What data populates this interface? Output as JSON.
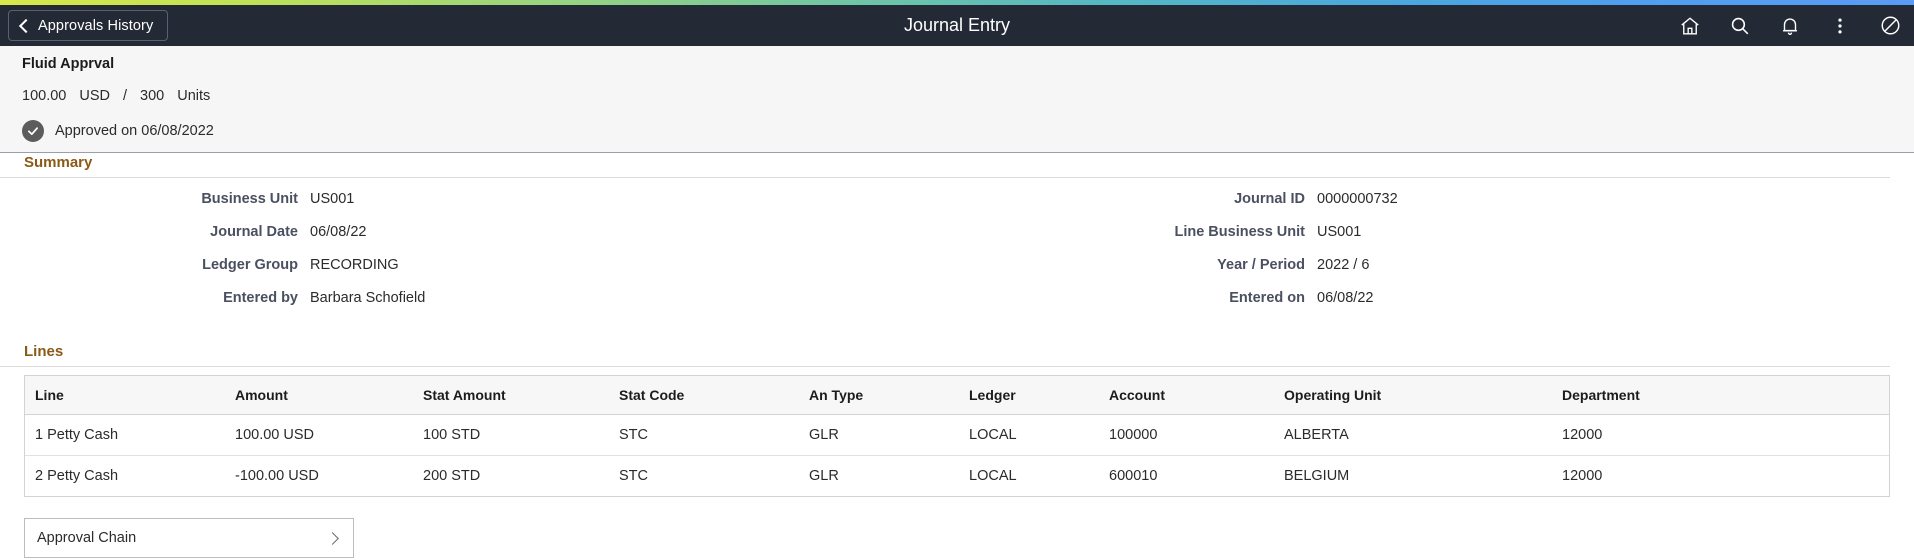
{
  "header": {
    "back_label": "Approvals History",
    "title": "Journal Entry",
    "icons": [
      {
        "name": "home-icon",
        "label": "Home"
      },
      {
        "name": "search-icon",
        "label": "Search"
      },
      {
        "name": "notifications-bell-icon",
        "label": "Notifications"
      },
      {
        "name": "actions-menu-icon",
        "label": "Actions"
      },
      {
        "name": "navbar-icon",
        "label": "NavBar"
      }
    ]
  },
  "info_band": {
    "fluid_title": "Fluid Apprval",
    "amount": "100.00",
    "currency": "USD",
    "separator": "/",
    "quantity": "300",
    "uom": "Units",
    "approval_status": "Approved on 06/08/2022"
  },
  "summary": {
    "heading": "Summary",
    "left_fields": [
      {
        "label": "Business Unit",
        "value": "US001"
      },
      {
        "label": "Journal Date",
        "value": "06/08/22"
      },
      {
        "label": "Ledger Group",
        "value": "RECORDING"
      },
      {
        "label": "Entered by",
        "value": "Barbara Schofield"
      }
    ],
    "right_fields": [
      {
        "label": "Journal ID",
        "value": "0000000732"
      },
      {
        "label": "Line Business Unit",
        "value": "US001"
      },
      {
        "label": "Year / Period",
        "value": "2022 / 6"
      },
      {
        "label": "Entered on",
        "value": "06/08/22"
      }
    ]
  },
  "lines": {
    "heading": "Lines",
    "columns": [
      "Line",
      "Amount",
      "Stat Amount",
      "Stat Code",
      "An Type",
      "Ledger",
      "Account",
      "Operating Unit",
      "Department"
    ],
    "rows": [
      {
        "line": "1 Petty Cash",
        "amount": "100.00 USD",
        "stat_amount": "100 STD",
        "stat_code": "STC",
        "an_type": "GLR",
        "ledger": "LOCAL",
        "account": "100000",
        "operating_unit": "ALBERTA",
        "department": "12000"
      },
      {
        "line": "2 Petty Cash",
        "amount": "-100.00 USD",
        "stat_amount": "200 STD",
        "stat_code": "STC",
        "an_type": "GLR",
        "ledger": "LOCAL",
        "account": "600010",
        "operating_unit": "BELGIUM",
        "department": "12000"
      }
    ]
  },
  "approval_chain": {
    "label": "Approval Chain"
  },
  "colors": {
    "header_bar": "#242a35",
    "section_heading": "#8a5a17",
    "info_band_bg": "#f6f6f6",
    "table_header_bg": "#f7f7f7",
    "status_icon": "#5c5c5c"
  }
}
